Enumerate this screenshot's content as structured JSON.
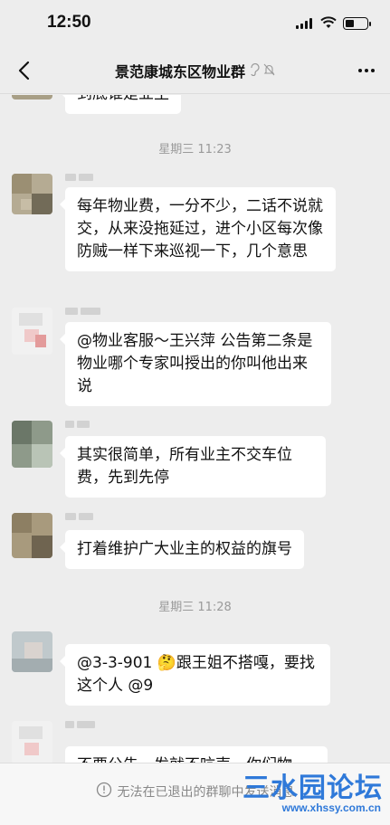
{
  "status_bar": {
    "time": "12:50"
  },
  "header": {
    "back_label": "返回",
    "title": "景范康城东区物业群"
  },
  "messages": [
    {
      "type": "message",
      "text": "到底谁是业主"
    },
    {
      "type": "timestamp",
      "text": "星期三 11:23"
    },
    {
      "type": "message",
      "text": "每年物业费，一分不少，二话不说就交，从来没拖延过，进个小区每次像防贼一样下来巡视一下，几个意思"
    },
    {
      "type": "message",
      "text": "@物业客服～王兴萍 公告第二条是物业哪个专家叫授出的你叫他出来说"
    },
    {
      "type": "message",
      "text": "其实很简单，所有业主不交车位费，先到先停"
    },
    {
      "type": "message",
      "text": "打着维护广大业主的权益的旗号"
    },
    {
      "type": "timestamp",
      "text": "星期三 11:28"
    },
    {
      "type": "message",
      "text": "@3-3-901 🤔跟王姐不搭嘎，要找这个人 @9"
    },
    {
      "type": "message",
      "text": "不要公告一发就不吭声，你们物"
    }
  ],
  "bottom_bar": {
    "notice": "无法在已退出的群聊中发送消息"
  },
  "watermark": {
    "title": "三水园论坛",
    "url": "www.xhssy.com.cn"
  },
  "colors": {
    "background": "#ededed",
    "bubble": "#ffffff",
    "watermark": "#2f79d9"
  }
}
